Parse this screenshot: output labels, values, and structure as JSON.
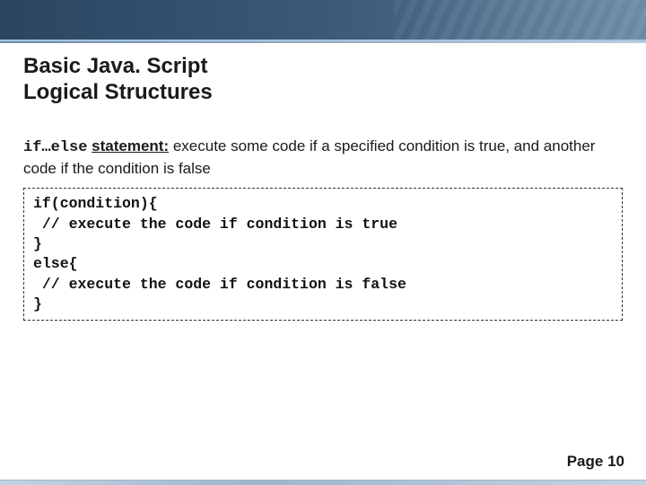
{
  "header": {
    "title_line1": "Basic Java. Script",
    "title_line2": "Logical Structures"
  },
  "body": {
    "keyword": "if…else",
    "statement_label": "statement:",
    "desc_tail": " execute some code if a specified condition is true, and another code if the condition is false",
    "code_lines": [
      "if(condition){",
      " // execute the code if condition is true",
      "}",
      "else{",
      " // execute the code if condition is false",
      "}"
    ]
  },
  "footer": {
    "page_prefix": "Page ",
    "page_number": "10"
  }
}
